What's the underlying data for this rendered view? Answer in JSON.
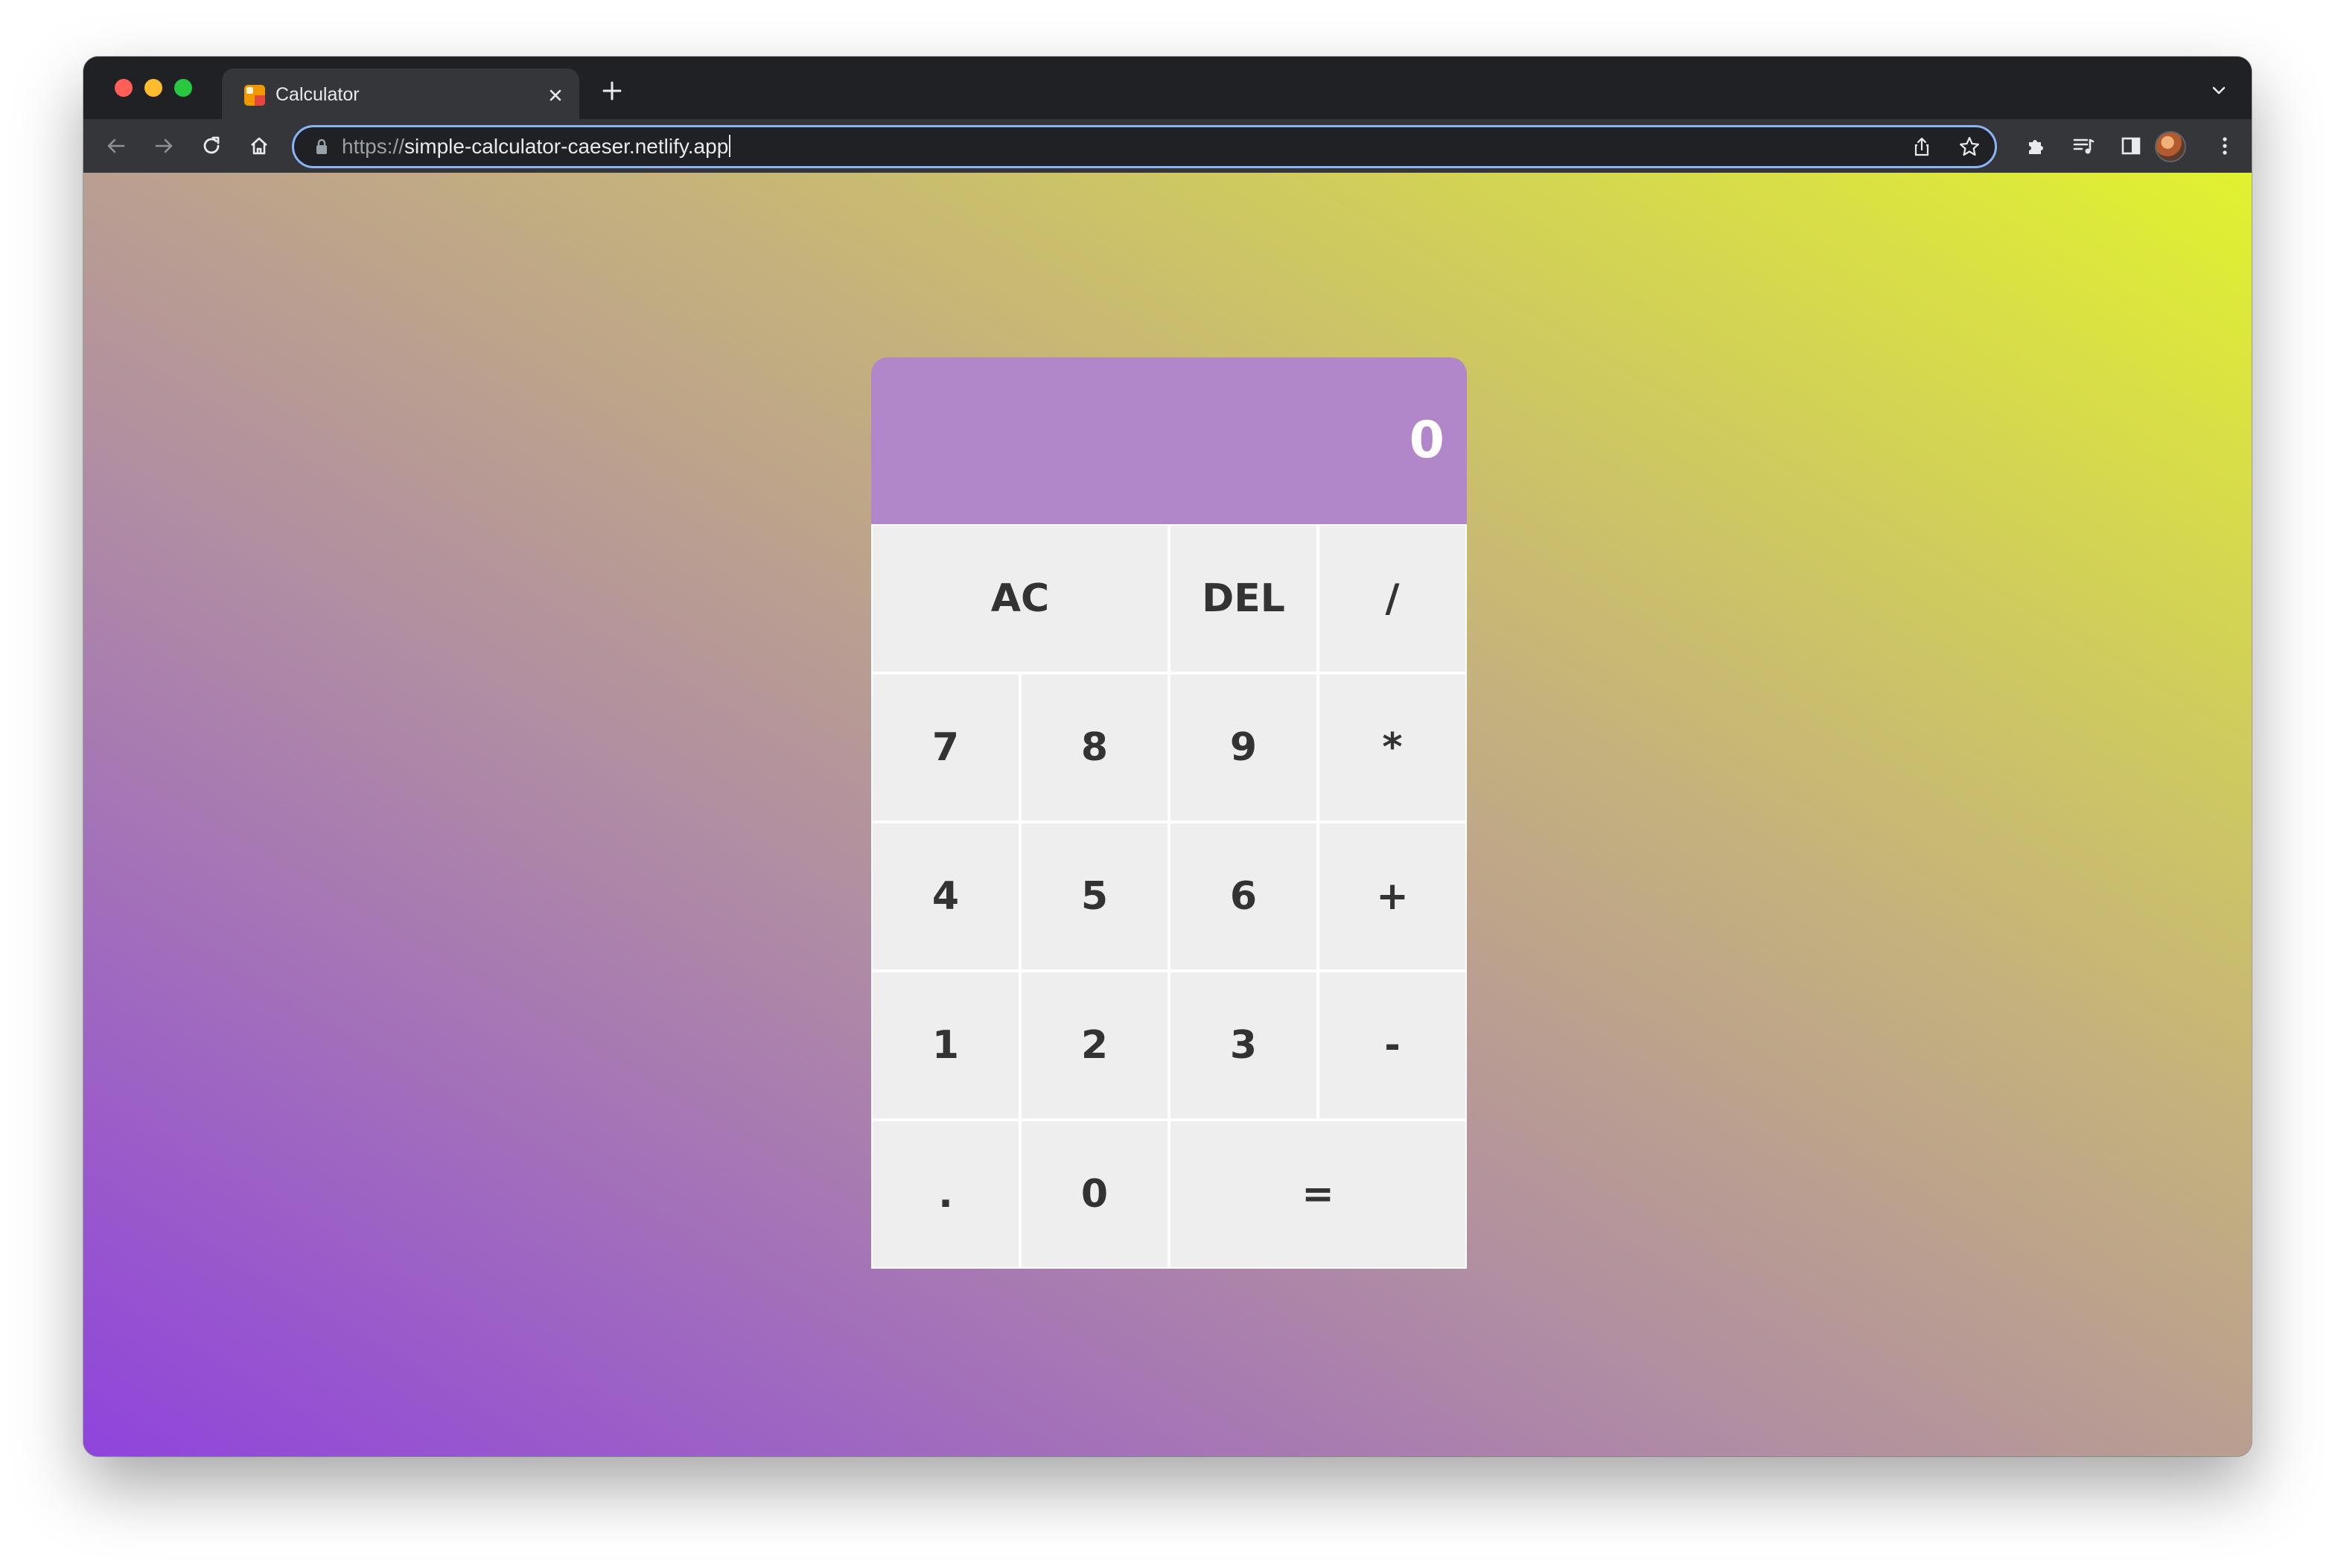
{
  "browser": {
    "tab": {
      "title": "Calculator",
      "close_icon": "close-icon",
      "favicon": "calculator-favicon"
    },
    "new_tab_icon": "plus-icon",
    "tab_menu_icon": "chevron-down-icon",
    "toolbar": {
      "back_icon": "arrow-left-icon",
      "forward_icon": "arrow-right-icon",
      "reload_icon": "reload-icon",
      "home_icon": "home-icon",
      "extensions_icon": "puzzle-icon",
      "media_icon": "media-queue-icon",
      "side_panel_icon": "side-panel-icon",
      "menu_icon": "kebab-menu-icon"
    },
    "omnibox": {
      "scheme": "https://",
      "host": "simple-calculator-caeser.netlify.app",
      "lock_icon": "lock-icon",
      "share_icon": "share-icon",
      "bookmark_icon": "star-icon"
    }
  },
  "calculator": {
    "display": "0",
    "keys": {
      "ac": "AC",
      "del": "DEL",
      "divide": "/",
      "seven": "7",
      "eight": "8",
      "nine": "9",
      "multiply": "*",
      "four": "4",
      "five": "5",
      "six": "6",
      "add": "+",
      "one": "1",
      "two": "2",
      "three": "3",
      "subtract": "-",
      "decimal": ".",
      "zero": "0",
      "equals": "="
    }
  },
  "colors": {
    "display_bg": "#b287c9",
    "key_bg": "#eeeeee",
    "key_text": "#333333",
    "gradient_start": "#8f44dc",
    "gradient_end": "#e1f22f"
  }
}
